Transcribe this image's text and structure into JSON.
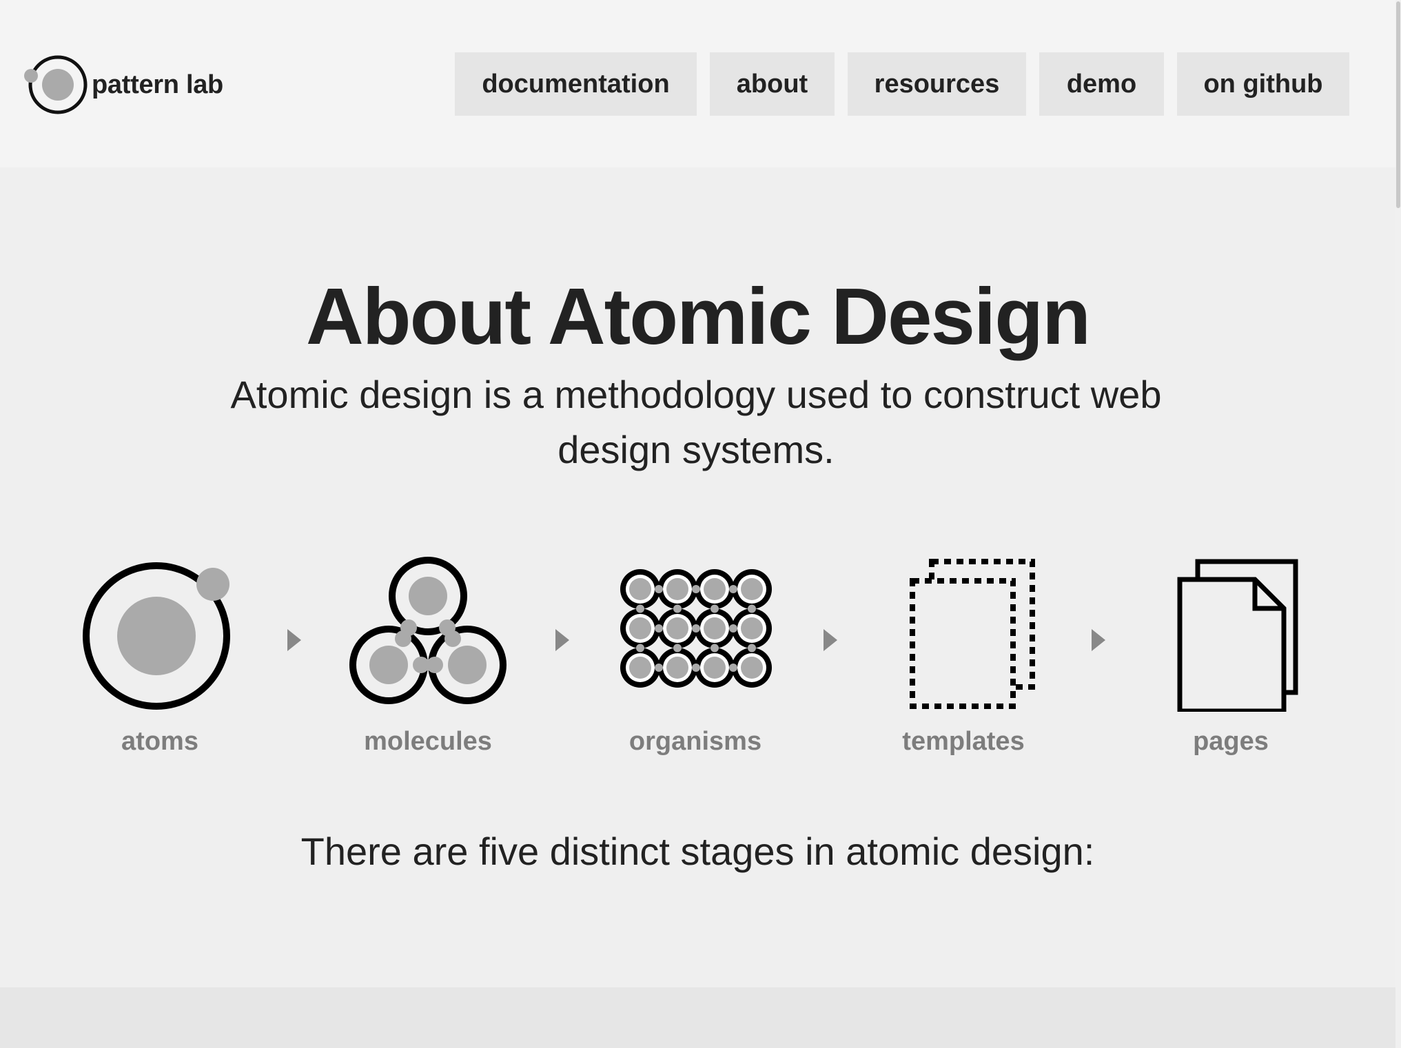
{
  "header": {
    "logo_text": "pattern lab",
    "nav": [
      {
        "label": "documentation"
      },
      {
        "label": "about"
      },
      {
        "label": "resources"
      },
      {
        "label": "demo"
      },
      {
        "label": "on github"
      }
    ]
  },
  "main": {
    "title": "About Atomic Design",
    "subtitle": "Atomic design is a methodology used to construct web design systems.",
    "stages": [
      {
        "label": "atoms",
        "icon": "atom-icon"
      },
      {
        "label": "molecules",
        "icon": "molecule-icon"
      },
      {
        "label": "organisms",
        "icon": "organism-icon"
      },
      {
        "label": "templates",
        "icon": "template-icon"
      },
      {
        "label": "pages",
        "icon": "pages-icon"
      }
    ],
    "lead": "There are five distinct stages in atomic design:"
  },
  "colors": {
    "header_bg": "#f4f4f4",
    "page_bg": "#efefef",
    "nav_bg": "#e5e5e5",
    "text": "#222222",
    "stage_label": "#7d7d7d",
    "icon_fill": "#aaaaaa"
  }
}
